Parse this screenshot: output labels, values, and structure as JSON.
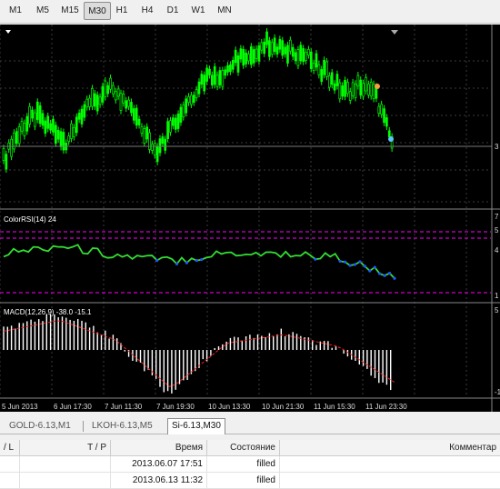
{
  "toolbar": {
    "timeframes": [
      "M1",
      "M5",
      "M15",
      "M30",
      "H1",
      "H4",
      "D1",
      "W1",
      "MN"
    ],
    "active": "M30"
  },
  "chart": {
    "rsi_label": "ColorRSI(14) 24",
    "macd_label": "MACD(12,26,9) -38.0 -15.1",
    "x_ticks": [
      "5 Jun 2013",
      "6 Jun 17:30",
      "7 Jun 11:30",
      "7 Jun 19:30",
      "10 Jun 13:30",
      "10 Jun 21:30",
      "11 Jun 15:30",
      "11 Jun 23:30"
    ],
    "rsi_right_ticks": [
      "7",
      "5",
      "4",
      "1"
    ],
    "macd_right_ticks": [
      "5",
      "-1"
    ],
    "price_right_label": "3",
    "colors": {
      "background": "#000000",
      "candles": "#00ff00",
      "rsi_line": "#33dd33",
      "rsi_low": "#2255ff",
      "macd_hist": "#ffffff",
      "macd_signal": "#ff2020",
      "grid": "#3a3a3a",
      "levels": "#ff00ff"
    }
  },
  "chart_data": {
    "type": "line",
    "x": [
      "5 Jun 2013",
      "6 Jun 17:30",
      "7 Jun 11:30",
      "7 Jun 19:30",
      "10 Jun 13:30",
      "10 Jun 21:30",
      "11 Jun 15:30",
      "11 Jun 23:30"
    ],
    "series": [
      {
        "name": "ColorRSI(14)",
        "values": [
          52,
          61,
          50,
          44,
          53,
          52,
          48,
          24
        ]
      },
      {
        "name": "MACD(12,26,9)",
        "values": [
          22,
          35,
          12,
          -45,
          8,
          18,
          4,
          -38
        ]
      }
    ]
  },
  "tabs": {
    "items": [
      "GOLD-6.13,M1",
      "LKOH-6.13,M5",
      "Si-6.13,M30"
    ],
    "active": "Si-6.13,M30"
  },
  "table": {
    "columns": [
      "/ L",
      "T / P",
      "Время",
      "Состояние",
      "Комментар"
    ],
    "rows": [
      {
        "time": "2013.06.07 17:51",
        "state": "filled"
      },
      {
        "time": "2013.06.13 11:32",
        "state": "filled"
      }
    ]
  }
}
